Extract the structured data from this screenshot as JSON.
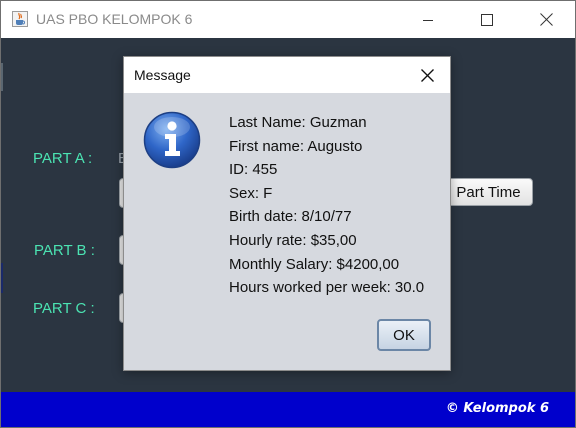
{
  "window": {
    "title": "UAS PBO KELOMPOK 6",
    "icon": "java-cup-icon",
    "controls": [
      "minimize-icon",
      "maximize-icon",
      "close-icon"
    ]
  },
  "background_form": {
    "part_labels": [
      "PART A :",
      "PART B :",
      "PART C :"
    ],
    "partial_text": "E",
    "part_time_button": "Part Time",
    "footer_text": "© Kelompok 6",
    "colors": {
      "panel": "#2b3541",
      "label": "#4be3b2",
      "footer": "#0000cc"
    }
  },
  "dialog": {
    "title": "Message",
    "icon": "info-icon",
    "lines": [
      "Last Name: Guzman",
      "First name: Augusto",
      "ID: 455",
      "Sex: F",
      "Birth date: 8/10/77",
      "Hourly rate: $35,00",
      "Monthly Salary: $4200,00",
      "Hours worked per week: 30.0"
    ],
    "ok_label": "OK"
  }
}
